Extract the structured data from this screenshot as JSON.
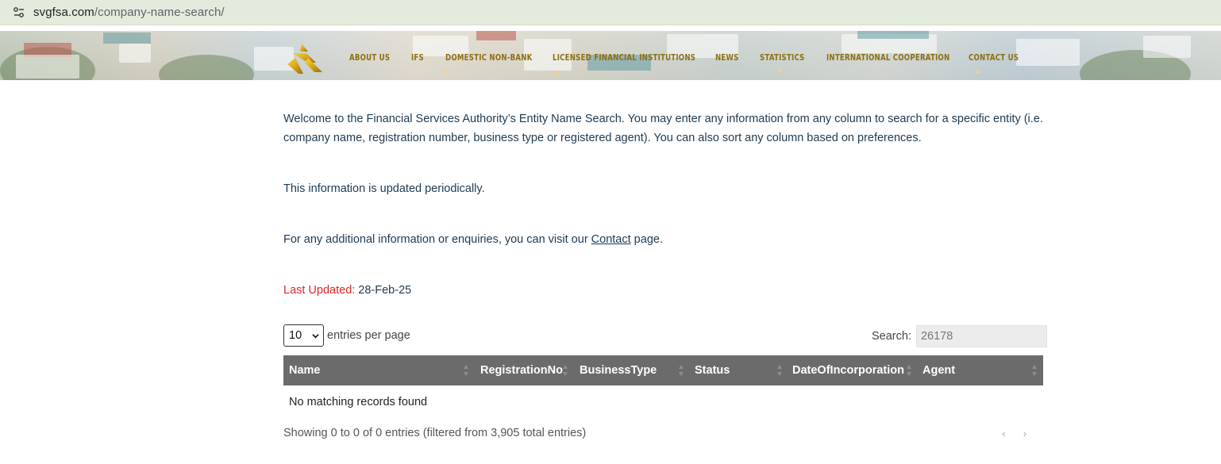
{
  "browser": {
    "url_host": "svgfsa.com",
    "url_path": "/company-name-search/",
    "site_info_icon": "tune-icon"
  },
  "nav": {
    "logo_icon": "fsa-logo-icon",
    "items": [
      {
        "label": "About Us"
      },
      {
        "label": "IFS"
      },
      {
        "label": "Domestic Non-Bank"
      },
      {
        "label": "Licensed Financial Institutions"
      },
      {
        "label": "News"
      },
      {
        "label": "Statistics"
      },
      {
        "label": "International Cooperation"
      },
      {
        "label": "Contact Us"
      }
    ]
  },
  "intro": {
    "paragraph1": "Welcome to the Financial Services Authority’s Entity Name Search. You may enter any information from any column to search for a specific entity (i.e. company name, registration number, business type or registered agent). You can also sort any column based on preferences.",
    "paragraph2": "This information is updated periodically.",
    "paragraph3_before": "For any additional information or enquiries, you can visit our ",
    "paragraph3_link": "Contact",
    "paragraph3_after": " page.",
    "last_updated_label": "Last Updated:",
    "last_updated_value": "28-Feb-25"
  },
  "table_controls": {
    "entries_value": "10",
    "entries_label": "entries per page",
    "search_label": "Search:",
    "search_value": "26178"
  },
  "table": {
    "columns": [
      "Name",
      "RegistrationNo",
      "BusinessType",
      "Status",
      "DateOfIncorporation",
      "Agent"
    ],
    "empty_message": "No matching records found"
  },
  "footer": {
    "info": "Showing 0 to 0 of 0 entries (filtered from 3,905 total entries)",
    "prev": "‹",
    "next": "›"
  },
  "colors": {
    "nav_text": "#8d6f12",
    "table_header_bg": "#6b6b6b",
    "last_updated_label": "#e02424",
    "body_text": "#1d3a52"
  }
}
